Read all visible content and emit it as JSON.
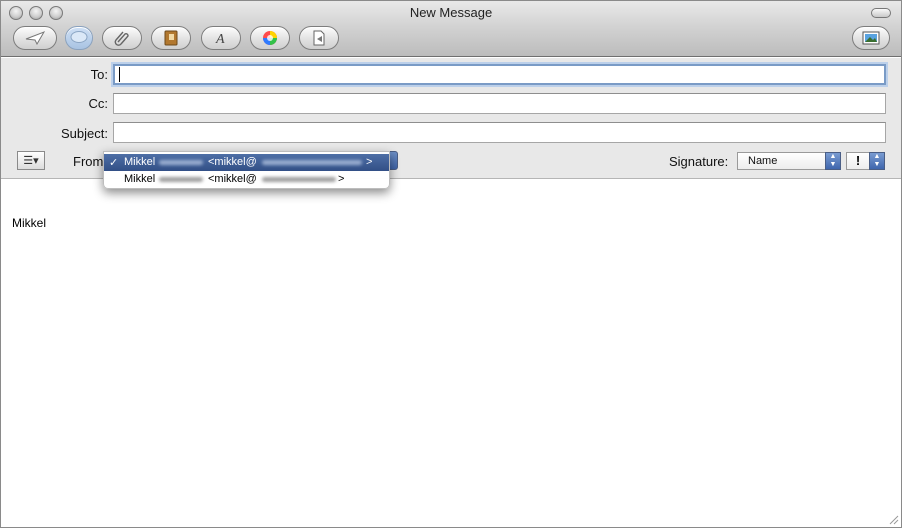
{
  "window": {
    "title": "New Message"
  },
  "toolbar": {
    "buttons": [
      {
        "name": "send",
        "icon": "paper-plane-icon"
      },
      {
        "name": "chat",
        "icon": "speech-bubble-icon"
      },
      {
        "name": "attach",
        "icon": "paperclip-icon"
      },
      {
        "name": "address",
        "icon": "address-book-icon"
      },
      {
        "name": "fonts",
        "icon": "font-icon"
      },
      {
        "name": "colors",
        "icon": "color-wheel-icon"
      },
      {
        "name": "stationery",
        "icon": "document-icon"
      },
      {
        "name": "photo-browser",
        "icon": "photo-icon"
      }
    ]
  },
  "fields": {
    "to_label": "To:",
    "to_value": "",
    "cc_label": "Cc:",
    "cc_value": "",
    "subject_label": "Subject:",
    "subject_value": "",
    "from_label": "From:",
    "signature_label": "Signature:",
    "signature_value": "Name",
    "priority_symbol": "!"
  },
  "from_menu": {
    "items": [
      {
        "check": "✓",
        "name": "Mikkel",
        "email_open": "<mikkel@",
        "email_close": ">",
        "selected": true
      },
      {
        "check": "",
        "name": "Mikkel",
        "email_open": "<mikkel@",
        "email_close": ">",
        "selected": false
      }
    ]
  },
  "body": {
    "text": "Mikkel"
  },
  "colors": {
    "menu_highlight": "#3f5f97",
    "focus_ring": "#7a9bc6",
    "stepper_blue": "#3f66ad"
  }
}
